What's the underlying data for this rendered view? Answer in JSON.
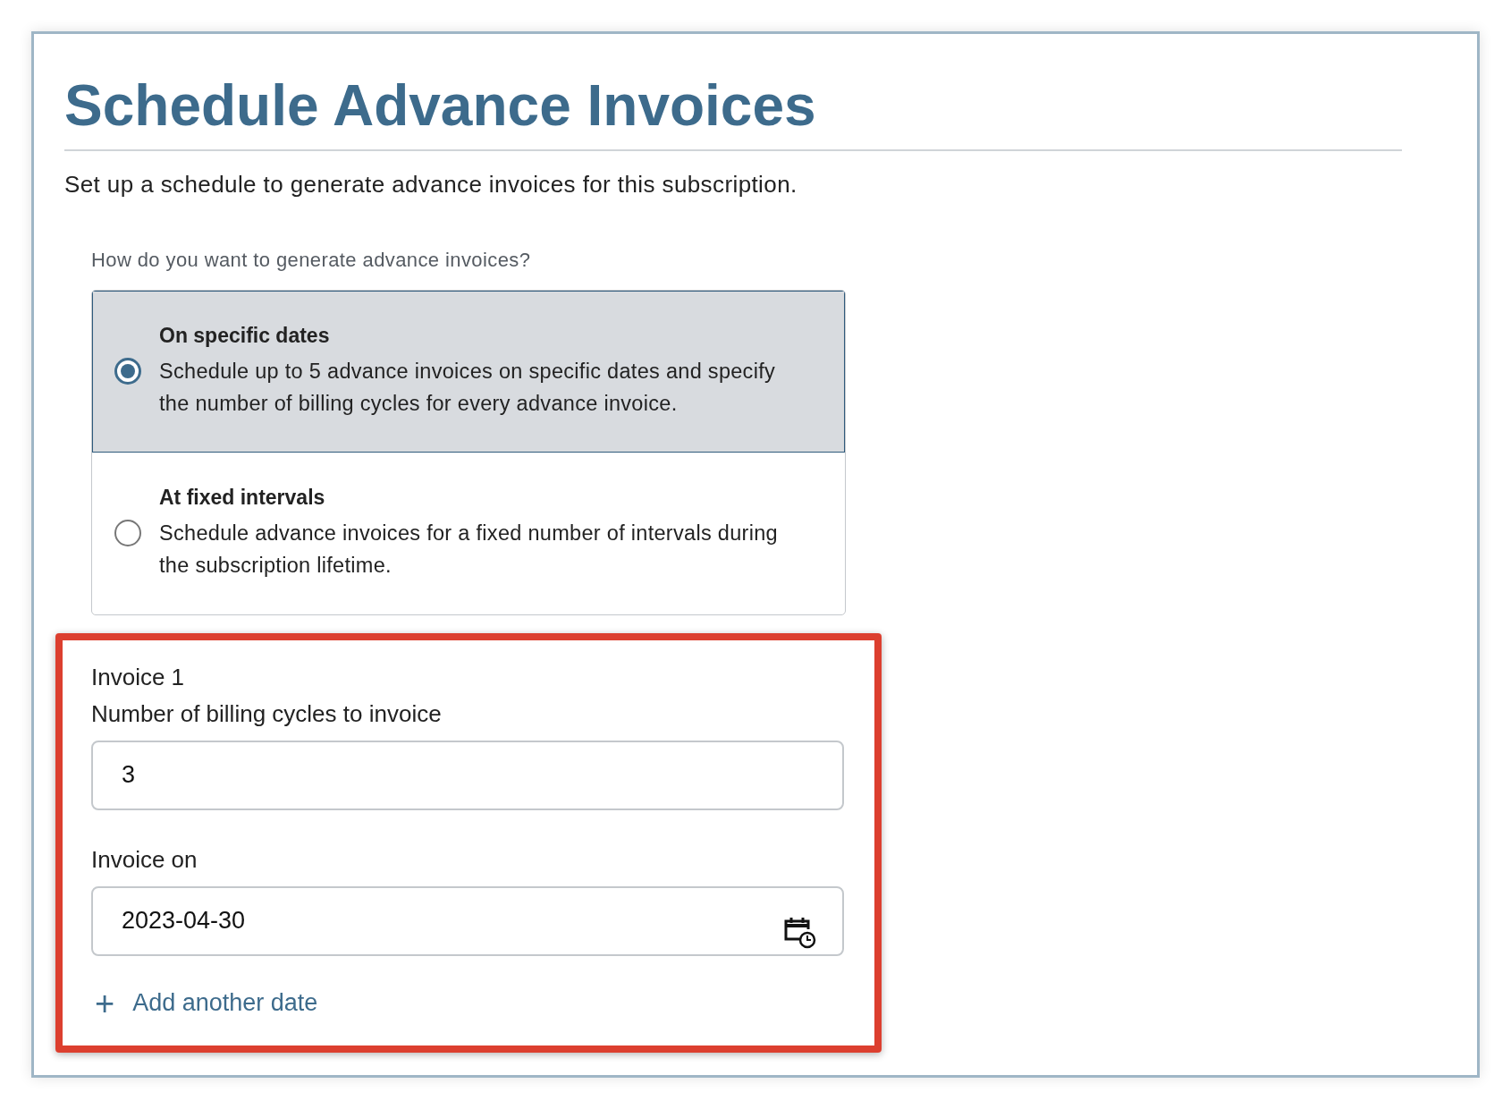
{
  "title": "Schedule Advance Invoices",
  "description": "Set up a schedule to generate advance invoices for this subscription.",
  "question": "How do you want to generate advance invoices?",
  "options": [
    {
      "title": "On specific dates",
      "description": "Schedule up to 5 advance invoices on specific dates and specify the number of billing cycles for every advance invoice.",
      "selected": true
    },
    {
      "title": "At fixed intervals",
      "description": "Schedule advance invoices for a fixed number of intervals during the subscription lifetime.",
      "selected": false
    }
  ],
  "invoice": {
    "heading": "Invoice 1",
    "cycles_label": "Number of billing cycles to invoice",
    "cycles_value": "3",
    "date_label": "Invoice on",
    "date_value": "2023-04-30"
  },
  "add_link": {
    "icon": "+",
    "label": "Add another date"
  }
}
